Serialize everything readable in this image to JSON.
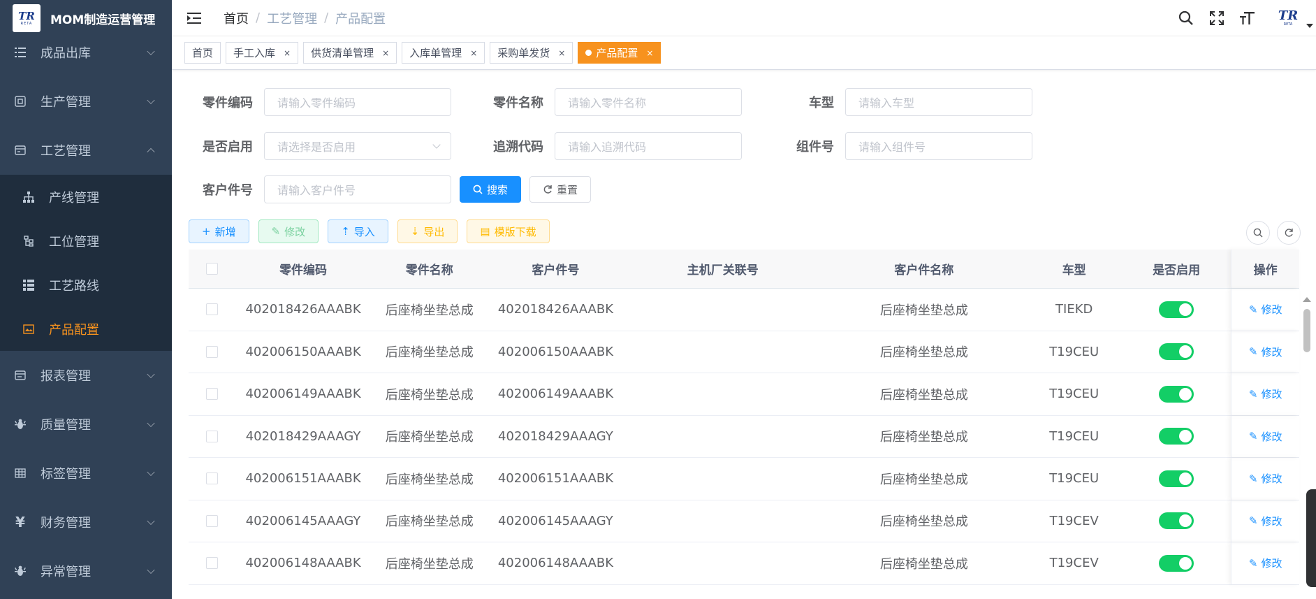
{
  "app": {
    "title": "MOM制造运营管理",
    "logo_text": "TR",
    "logo_sub": "RETA"
  },
  "sidebar": {
    "items_top": [
      {
        "label": "成品出库",
        "icon": "list-icon"
      },
      {
        "label": "生产管理",
        "icon": "cpu-icon"
      },
      {
        "label": "工艺管理",
        "icon": "card-icon",
        "expanded": true
      }
    ],
    "sub_items": [
      {
        "label": "产线管理",
        "icon": "hierarchy-icon",
        "active": false
      },
      {
        "label": "工位管理",
        "icon": "tree-icon",
        "active": false
      },
      {
        "label": "工艺路线",
        "icon": "route-icon",
        "active": false
      },
      {
        "label": "产品配置",
        "icon": "image-icon",
        "active": true
      }
    ],
    "items_bottom": [
      {
        "label": "报表管理",
        "icon": "report-icon"
      },
      {
        "label": "质量管理",
        "icon": "bug-icon"
      },
      {
        "label": "标签管理",
        "icon": "table-icon"
      },
      {
        "label": "财务管理",
        "icon": "yen-icon"
      },
      {
        "label": "异常管理",
        "icon": "bug-icon"
      }
    ]
  },
  "breadcrumb": [
    "首页",
    "工艺管理",
    "产品配置"
  ],
  "tags": [
    {
      "label": "首页",
      "closable": false,
      "active": false
    },
    {
      "label": "手工入库",
      "closable": true,
      "active": false
    },
    {
      "label": "供货清单管理",
      "closable": true,
      "active": false
    },
    {
      "label": "入库单管理",
      "closable": true,
      "active": false
    },
    {
      "label": "采购单发货",
      "closable": true,
      "active": false
    },
    {
      "label": "产品配置",
      "closable": true,
      "active": true
    }
  ],
  "tag_close": "×",
  "search": {
    "part_code": {
      "label": "零件编码",
      "placeholder": "请输入零件编码"
    },
    "part_name": {
      "label": "零件名称",
      "placeholder": "请输入零件名称"
    },
    "car_model": {
      "label": "车型",
      "placeholder": "请输入车型"
    },
    "enabled": {
      "label": "是否启用",
      "placeholder": "请选择是否启用"
    },
    "trace_code": {
      "label": "追溯代码",
      "placeholder": "请输入追溯代码"
    },
    "assembly_no": {
      "label": "组件号",
      "placeholder": "请输入组件号"
    },
    "customer_part": {
      "label": "客户件号",
      "placeholder": "请输入客户件号"
    },
    "search_button": "搜索",
    "reset_button": "重置"
  },
  "toolbar": {
    "add": "新增",
    "edit": "修改",
    "import": "导入",
    "export": "导出",
    "template": "模版下载"
  },
  "table": {
    "headers": {
      "part_code": "零件编码",
      "part_name": "零件名称",
      "customer_part": "客户件号",
      "host_part": "主机厂关联号",
      "customer_part_name": "客户件名称",
      "car_model": "车型",
      "enabled": "是否启用",
      "op": "操作"
    },
    "op_label": "修改",
    "rows": [
      {
        "part_code": "402018426AAABK",
        "part_name": "后座椅坐垫总成",
        "customer_part": "402018426AAABK",
        "host_part": "",
        "customer_part_name": "后座椅坐垫总成",
        "car_model": "TIEKD",
        "enabled": true
      },
      {
        "part_code": "402006150AAABK",
        "part_name": "后座椅坐垫总成",
        "customer_part": "402006150AAABK",
        "host_part": "",
        "customer_part_name": "后座椅坐垫总成",
        "car_model": "T19CEU",
        "enabled": true
      },
      {
        "part_code": "402006149AAABK",
        "part_name": "后座椅坐垫总成",
        "customer_part": "402006149AAABK",
        "host_part": "",
        "customer_part_name": "后座椅坐垫总成",
        "car_model": "T19CEU",
        "enabled": true
      },
      {
        "part_code": "402018429AAAGY",
        "part_name": "后座椅坐垫总成",
        "customer_part": "402018429AAAGY",
        "host_part": "",
        "customer_part_name": "后座椅坐垫总成",
        "car_model": "T19CEU",
        "enabled": true
      },
      {
        "part_code": "402006151AAABK",
        "part_name": "后座椅坐垫总成",
        "customer_part": "402006151AAABK",
        "host_part": "",
        "customer_part_name": "后座椅坐垫总成",
        "car_model": "T19CEU",
        "enabled": true
      },
      {
        "part_code": "402006145AAAGY",
        "part_name": "后座椅坐垫总成",
        "customer_part": "402006145AAAGY",
        "host_part": "",
        "customer_part_name": "后座椅坐垫总成",
        "car_model": "T19CEV",
        "enabled": true
      },
      {
        "part_code": "402006148AAABK",
        "part_name": "后座椅坐垫总成",
        "customer_part": "402006148AAABK",
        "host_part": "",
        "customer_part_name": "后座椅坐垫总成",
        "car_model": "T19CEV",
        "enabled": true
      }
    ]
  },
  "colors": {
    "sidebar_bg": "#304156",
    "submenu_bg": "#1f2d3d",
    "accent": "#f7921e",
    "primary": "#1890ff",
    "switch_on": "#13ce66"
  }
}
